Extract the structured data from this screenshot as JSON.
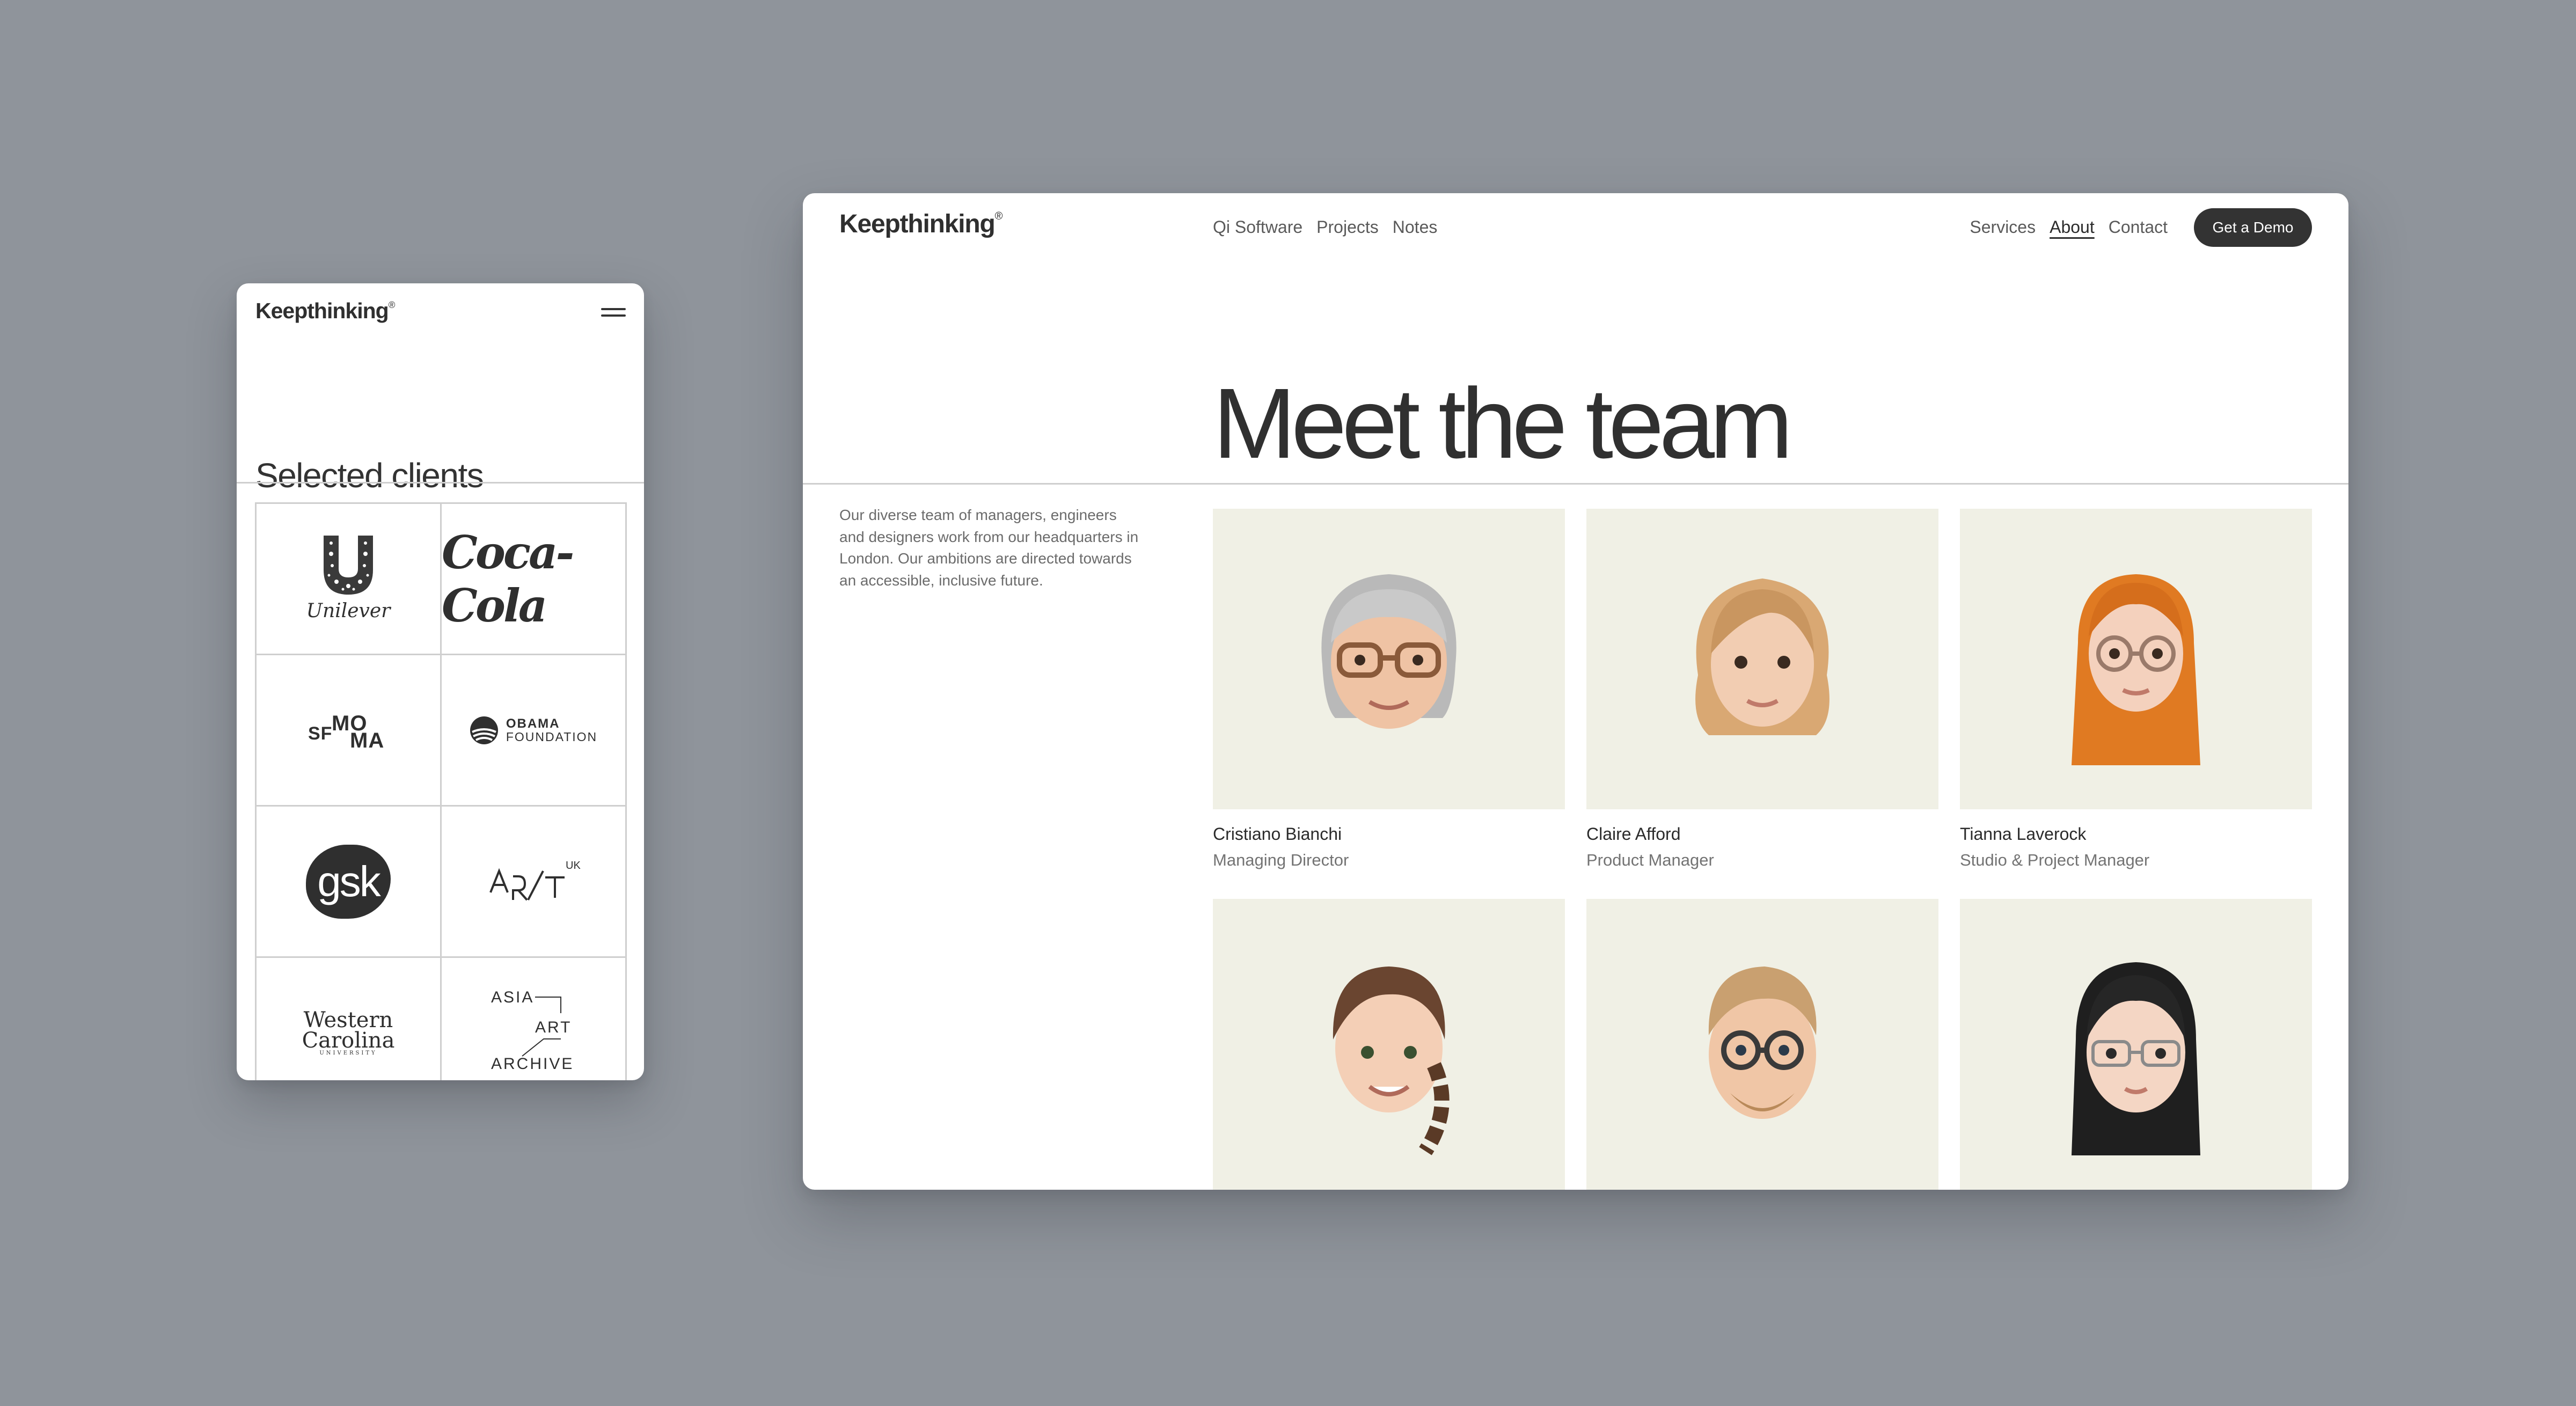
{
  "mobile": {
    "logo": "Keepthinking",
    "logo_mark": "®",
    "heading": "Selected clients",
    "clients": {
      "unilever": "Unilever",
      "cocacola": "Coca-Cola",
      "sfmoma_sf": "SF",
      "sfmoma_mo": "MO",
      "sfmoma_ma": "MA",
      "obama_line1": "OBAMA",
      "obama_line2": "FOUNDATION",
      "gsk": "gsk",
      "artuk_sup": "UK",
      "wcu_line1": "Western",
      "wcu_line2": "Carolina",
      "wcu_line3": "UNIVERSITY",
      "asia_line1": "ASIA",
      "asia_line2": "ART",
      "asia_line3": "ARCHIVE"
    }
  },
  "desktop": {
    "logo": "Keepthinking",
    "logo_mark": "®",
    "nav_left": [
      "Qi Software",
      "Projects",
      "Notes"
    ],
    "nav_right": [
      "Services",
      "About",
      "Contact"
    ],
    "active_nav": "About",
    "cta": "Get a Demo",
    "title": "Meet the team",
    "intro": "Our diverse team of managers, engineers and designers work from our headquarters in London. Our ambitions are directed towards an accessible, inclusive future.",
    "team": [
      {
        "name": "Cristiano Bianchi",
        "role": "Managing Director"
      },
      {
        "name": "Claire Afford",
        "role": "Product Manager"
      },
      {
        "name": "Tianna Laverock",
        "role": "Studio & Project Manager"
      },
      {
        "name": "",
        "role": ""
      },
      {
        "name": "",
        "role": ""
      },
      {
        "name": "",
        "role": ""
      }
    ]
  },
  "colors": {
    "background": "#8f949b",
    "card": "#ffffff",
    "avatar_bg": "#f0f0e5",
    "button": "#333333"
  }
}
